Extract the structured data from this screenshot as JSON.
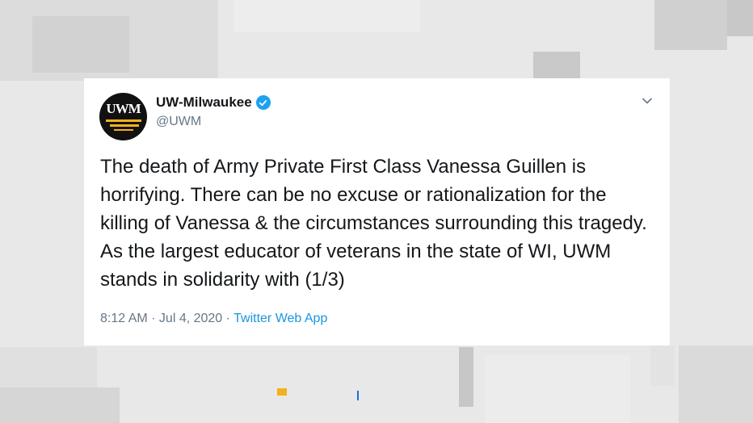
{
  "tweet": {
    "avatar_text": "UWM",
    "display_name": "UW-Milwaukee",
    "handle": "@UWM",
    "text": "The death of Army Private First Class Vanessa Guillen is horrifying. There can be no excuse or rationalization for the killing of Vanessa & the circumstances surrounding this tragedy. As the largest educator of veterans in the state of WI, UWM stands in solidarity with (1/3)",
    "time": "8:12 AM",
    "separator": " · ",
    "date": "Jul 4, 2020",
    "source": "Twitter Web App"
  },
  "icons": {
    "verified": "verified-badge-icon",
    "menu": "chevron-down-icon"
  },
  "colors": {
    "text_primary": "#14171a",
    "text_secondary": "#657786",
    "link": "#1b95e0",
    "verified": "#1da1f2",
    "accent_gold": "#f2b21b"
  }
}
